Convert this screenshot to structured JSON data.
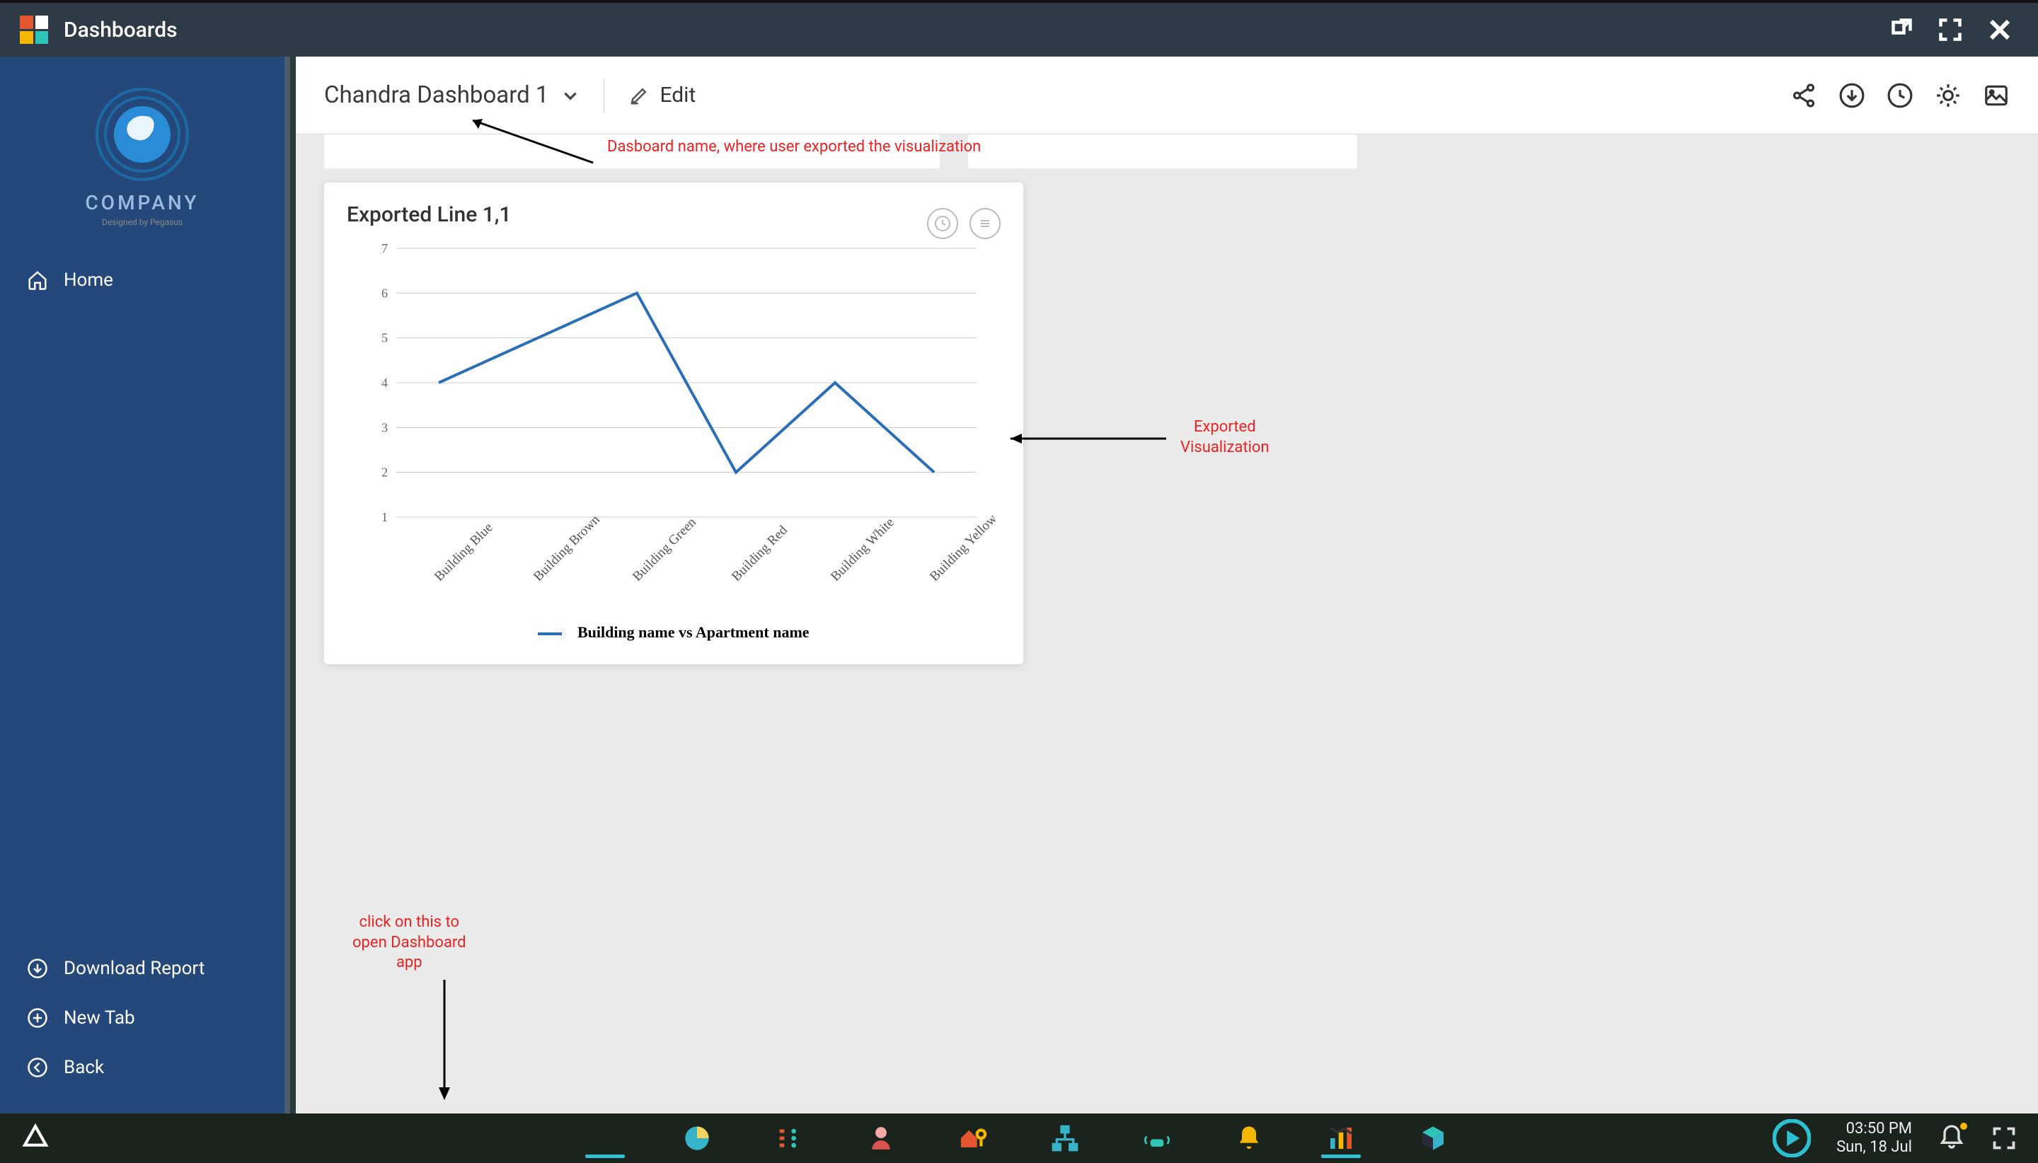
{
  "window": {
    "title": "Dashboards"
  },
  "sidebar": {
    "company": "COMPANY",
    "tagline": "Designed by Pegasus",
    "home": "Home",
    "download": "Download Report",
    "newtab": "New Tab",
    "back": "Back"
  },
  "toolbar": {
    "dashboard_name": "Chandra Dashboard 1",
    "edit": "Edit"
  },
  "annotations": {
    "dash_name": "Dasboard name, where user exported the visualization",
    "exported": "Exported\nVisualization",
    "taskbar_hint": "click on this to\nopen Dashboard\napp"
  },
  "chart_card": {
    "title": "Exported Line 1,1"
  },
  "chart_data": {
    "type": "line",
    "title": "Exported Line 1,1",
    "xlabel": "",
    "ylabel": "",
    "ylim": [
      1,
      7
    ],
    "y_ticks": [
      1,
      2,
      3,
      4,
      5,
      6,
      7
    ],
    "categories": [
      "Building Blue",
      "Building Brown",
      "Building Green",
      "Building Red",
      "Building White",
      "Building Yellow"
    ],
    "series": [
      {
        "name": "Building name vs Apartment name",
        "values": [
          4,
          5,
          6,
          2,
          4,
          2
        ]
      }
    ],
    "legend_position": "bottom",
    "grid": true
  },
  "clock": {
    "time": "03:50 PM",
    "date": "Sun, 18 Jul"
  }
}
